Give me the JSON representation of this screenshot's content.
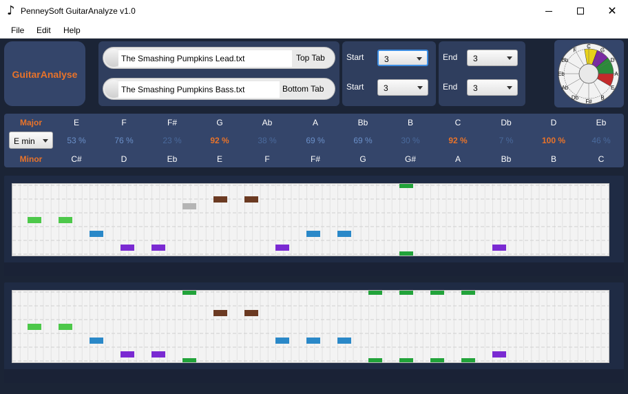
{
  "window": {
    "title": "PenneySoft GuitarAnalyze v1.0",
    "app_icon": "music-note-icon"
  },
  "menu": [
    "File",
    "Edit",
    "Help"
  ],
  "logo": {
    "text": "GuitarAnalyse"
  },
  "files": {
    "top": {
      "value": "The Smashing Pumpkins Lead.txt",
      "label": "Top Tab"
    },
    "bottom": {
      "value": "The Smashing Pumpkins Bass.txt",
      "label": "Bottom Tab"
    }
  },
  "range": {
    "start_label": "Start",
    "end_label": "End",
    "top_start": "3",
    "top_end": "3",
    "bottom_start": "3",
    "bottom_end": "3"
  },
  "circle_of_fifths": {
    "outer": [
      "C",
      "G",
      "D",
      "A",
      "E",
      "B",
      "F#",
      "Db",
      "Ab",
      "Eb",
      "Bb",
      "F"
    ],
    "segment_colors": [
      "#e8d21a",
      "#7a2aa3",
      "#2b8a3a",
      "#c32a2a"
    ]
  },
  "keys": {
    "major_label": "Major",
    "minor_label": "Minor",
    "selected_key": "E min",
    "major": [
      "E",
      "F",
      "F#",
      "G",
      "Ab",
      "A",
      "Bb",
      "B",
      "C",
      "Db",
      "D",
      "Eb"
    ],
    "minor": [
      "C#",
      "D",
      "Eb",
      "E",
      "F",
      "F#",
      "G",
      "G#",
      "A",
      "Bb",
      "B",
      "C"
    ],
    "percent": [
      "53 %",
      "76 %",
      "23 %",
      "92 %",
      "38 %",
      "69 %",
      "69 %",
      "30 %",
      "92 %",
      "7 %",
      "100 %",
      "46 %"
    ],
    "highlight": [
      false,
      false,
      false,
      true,
      false,
      false,
      false,
      false,
      true,
      false,
      true,
      false
    ],
    "colors": {
      "dim": "#4a6a9c",
      "mid": "#6a8fc8",
      "highlight": "#e8732a"
    }
  },
  "tabs": {
    "colors": {
      "green": "#4dc84a",
      "blue": "#2a88c8",
      "purple": "#7a2ad2",
      "brown": "#6b3a22",
      "gray": "#b5b5b5",
      "dark_green": "#22a33a"
    },
    "top_notes": [
      {
        "beat": 0,
        "string": 2,
        "color": "green"
      },
      {
        "beat": 1,
        "string": 2,
        "color": "green"
      },
      {
        "beat": 2,
        "string": 3,
        "color": "blue"
      },
      {
        "beat": 3,
        "string": 4,
        "color": "purple"
      },
      {
        "beat": 4,
        "string": 4,
        "color": "purple"
      },
      {
        "beat": 5,
        "string": 1,
        "color": "gray"
      },
      {
        "beat": 6,
        "string": 0.5,
        "color": "brown"
      },
      {
        "beat": 7,
        "string": 0.5,
        "color": "brown"
      },
      {
        "beat": 8,
        "string": 4,
        "color": "purple"
      },
      {
        "beat": 9,
        "string": 3,
        "color": "blue"
      },
      {
        "beat": 10,
        "string": 3,
        "color": "blue"
      },
      {
        "beat": 12,
        "string": 0,
        "color": "dark_green"
      },
      {
        "beat": 12,
        "string": 5,
        "color": "dark_green"
      },
      {
        "beat": 15,
        "string": 4,
        "color": "purple"
      }
    ],
    "bottom_notes": [
      {
        "beat": 0,
        "string": 2,
        "color": "green"
      },
      {
        "beat": 1,
        "string": 2,
        "color": "green"
      },
      {
        "beat": 2,
        "string": 3,
        "color": "blue"
      },
      {
        "beat": 3,
        "string": 4,
        "color": "purple"
      },
      {
        "beat": 4,
        "string": 4,
        "color": "purple"
      },
      {
        "beat": 5,
        "string": 0,
        "color": "dark_green"
      },
      {
        "beat": 5,
        "string": 5,
        "color": "dark_green"
      },
      {
        "beat": 6,
        "string": 1,
        "color": "brown"
      },
      {
        "beat": 7,
        "string": 1,
        "color": "brown"
      },
      {
        "beat": 8,
        "string": 3,
        "color": "blue"
      },
      {
        "beat": 9,
        "string": 3,
        "color": "blue"
      },
      {
        "beat": 10,
        "string": 3,
        "color": "blue"
      },
      {
        "beat": 11,
        "string": 0,
        "color": "dark_green"
      },
      {
        "beat": 11,
        "string": 5,
        "color": "dark_green"
      },
      {
        "beat": 12,
        "string": 0,
        "color": "dark_green"
      },
      {
        "beat": 12,
        "string": 5,
        "color": "dark_green"
      },
      {
        "beat": 13,
        "string": 0,
        "color": "dark_green"
      },
      {
        "beat": 13,
        "string": 5,
        "color": "dark_green"
      },
      {
        "beat": 14,
        "string": 0,
        "color": "dark_green"
      },
      {
        "beat": 14,
        "string": 5,
        "color": "dark_green"
      },
      {
        "beat": 15,
        "string": 4,
        "color": "purple"
      }
    ]
  }
}
